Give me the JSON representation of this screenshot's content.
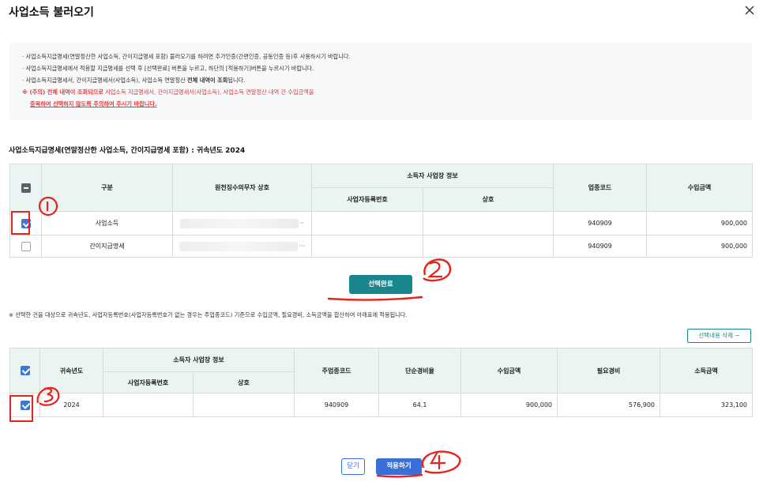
{
  "dialog": {
    "title": "사업소득 불러오기",
    "close_label": "×"
  },
  "notice": {
    "line1": "· 사업소득지급명세(연말정산한 사업소득, 간이지급명세 포함) 불러오기를 하려면 추가인증(간편인증, 공동인증 등)후 사용하시기 바랍니다.",
    "line2": "· 사업소득지급명세에서 적용할 지급명세를 선택 후 [선택완료] 버튼을 누르고, 하단의 [적용하기]버튼을 누르시기 바랍니다.",
    "line3_a": "· 사업소득지급명세서, 간이지급명세서(사업소득), 사업소득 연말정산 ",
    "line3_b": "전체 내역이 조회",
    "line3_c": "됩니다.",
    "warn_a": "※ (주의) 전체 내역이 조회되므로",
    "warn_b": " 사업소득 지급명세서, 간이지급명세서(사업소득), 사업소득 연말정산 내역 간 수입금액을",
    "warn_c": "중복하여 선택하지 않도록 주의하여 주시기 바랍니다."
  },
  "section_title": "사업소득지급명세(연말정산한 사업소득, 간이지급명세 포함) : 귀속년도 2024",
  "top_table": {
    "headers": {
      "category": "구분",
      "payer": "원천징수의무자 상호",
      "group": "소득자 사업장 정보",
      "reg_no": "사업자등록번호",
      "trade_name": "상호",
      "industry_code": "업종코드",
      "income": "수입금액"
    },
    "rows": [
      {
        "category": "사업소득",
        "payer_suffix": "··",
        "reg_no": "",
        "trade_name": "",
        "industry_code": "940909",
        "income": "900,000",
        "checked": true
      },
      {
        "category": "간이지급명세",
        "payer_suffix": "···",
        "reg_no": "",
        "trade_name": "",
        "industry_code": "940909",
        "income": "900,000",
        "checked": false
      }
    ]
  },
  "select_done_button": "선택완료",
  "note2": "※ 선택한 건을 대상으로 귀속년도, 사업자등록번호(사업자등록번호가 없는 경우는 주업종코드) 기준으로 수입금액, 필요경비, 소득금액을 합산하여 아래표에 적용됩니다.",
  "delete_button": "선택내용 삭제 −",
  "bottom_table": {
    "headers": {
      "year": "귀속년도",
      "group": "소득자 사업장 정보",
      "reg_no": "사업자등록번호",
      "trade_name": "상호",
      "main_code": "주업종코드",
      "rate": "단순경비율",
      "income": "수입금액",
      "expense": "필요경비",
      "profit": "소득금액"
    },
    "rows": [
      {
        "year": "2024",
        "reg_no": "",
        "trade_name": "",
        "main_code": "940909",
        "rate": "64.1",
        "income": "900,000",
        "expense": "576,900",
        "profit": "323,100",
        "checked": true
      }
    ]
  },
  "footer": {
    "close_button": "닫기",
    "apply_button": "적용하기"
  },
  "annotations": [
    "①",
    "②",
    "③",
    "④"
  ],
  "colors": {
    "accent_teal": "#19858c",
    "accent_blue": "#3b6fd8",
    "checkbox_blue": "#3b78d8",
    "warn_red": "#e23b3b",
    "annotation_red": "#e8221c",
    "header_bg": "#eaf4f3"
  }
}
